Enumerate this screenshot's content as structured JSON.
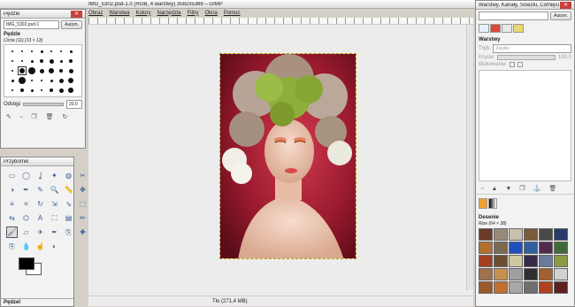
{
  "main_window": {
    "title": "IMG_5302.psd-1.0 (RGB, 4 warstwy) 3582x5388 – GIMP",
    "menu": [
      "Obraz",
      "Warstwa",
      "Kolory",
      "Narzędzia",
      "Filtry",
      "Okna",
      "Pomoc"
    ],
    "status": "Tło (271,4 MB)"
  },
  "brushes_window": {
    "title": "Pędzle",
    "image_combo": "IMG_5302.psd-1",
    "auto_button": "Autom.",
    "section": "Pędzle",
    "brush_name": "Circle (11) (13 × 13)",
    "spacing_label": "Odstęp",
    "spacing_value": "20.0",
    "selected_index": 15
  },
  "toolbox_window": {
    "title": "Przybornik",
    "bottom_label": "Pędzel",
    "fg_color": "#000000",
    "bg_color": "#ffffff",
    "tools": [
      "select-rect",
      "select-ellipse",
      "lasso",
      "fuzzy-select",
      "color-select",
      "scissors",
      "foreground-select",
      "paths",
      "color-picker",
      "zoom",
      "measure",
      "move",
      "align",
      "crop",
      "rotate",
      "scale",
      "shear",
      "perspective",
      "flip",
      "cage",
      "text",
      "bucket-fill",
      "blend",
      "pencil",
      "paintbrush",
      "eraser",
      "airbrush",
      "ink",
      "clone",
      "heal",
      "perspective-clone",
      "blur",
      "smudge",
      "dodge-burn"
    ],
    "selected_tool": "paintbrush"
  },
  "layers_window": {
    "title": "Warstwy, Kanały, Ścieżki, Cofnięcie ...",
    "auto_button": "Autom.",
    "section": "Warstwy",
    "mode_label": "Tryb:",
    "mode_value": "Zwykły",
    "opacity_label": "Krycie:",
    "opacity_value": "100,0",
    "lock_label": "Blokowanie:"
  },
  "patterns": {
    "section": "Desenie",
    "name": "Rize (64 × 38)",
    "colors": [
      "#6a3a2a",
      "#9a8a7a",
      "#c8c0b0",
      "#7a5a3a",
      "#4a4a4a",
      "#2a3a6a",
      "#b07030",
      "#7a6a50",
      "#2050c0",
      "#3060a0",
      "#502a50",
      "#406a3a",
      "#a04020",
      "#6a5030",
      "#d0c8a0",
      "#3a2a4a",
      "#6a7a9a",
      "#8a9a40",
      "#a07050",
      "#c89050",
      "#a0a0a0",
      "#303030",
      "#a06030",
      "#d0d0d0",
      "#9a5a2a",
      "#c07030",
      "#a8a8a8",
      "#707070",
      "#b04020",
      "#602020"
    ]
  }
}
